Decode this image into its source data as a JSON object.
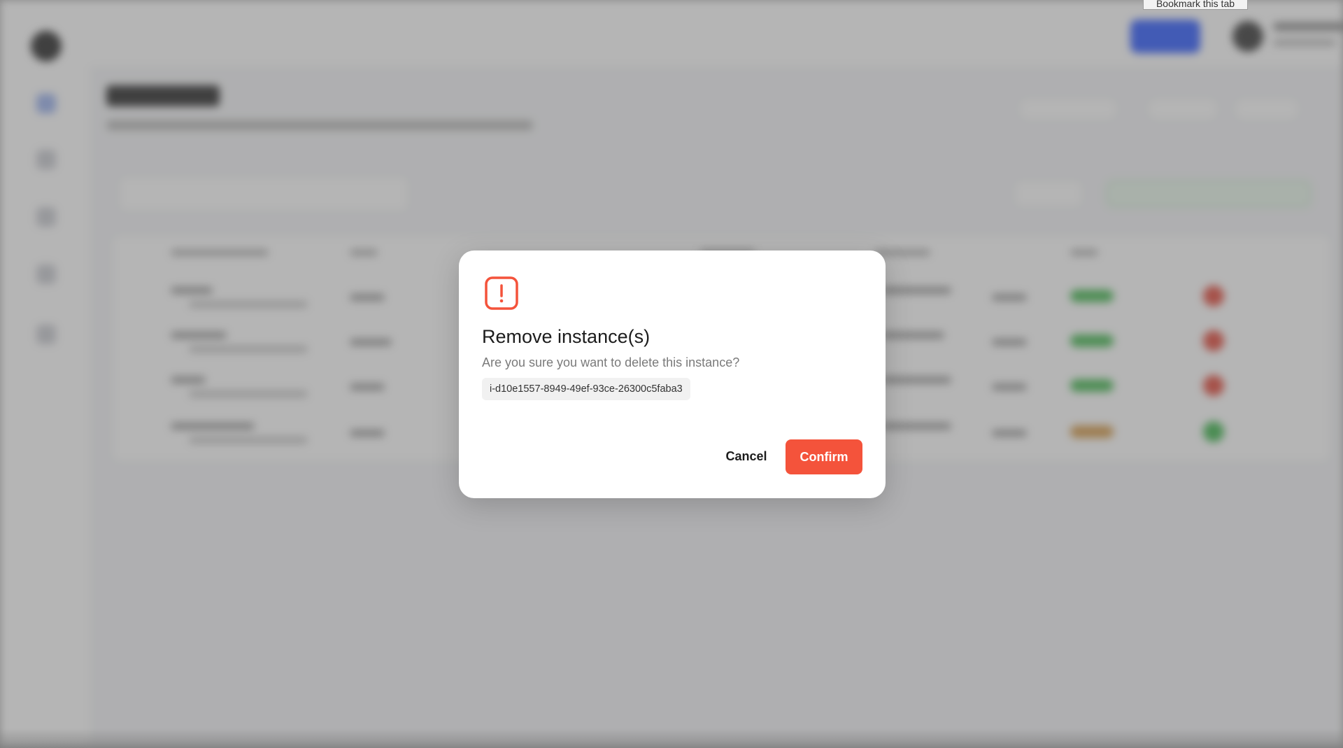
{
  "tooltip": {
    "text": "Bookmark this tab"
  },
  "dialog": {
    "title": "Remove instance(s)",
    "message": "Are you sure you want to delete this instance?",
    "instance_id": "i-d10e1557-8949-49ef-93ce-26300c5faba3",
    "cancel_label": "Cancel",
    "confirm_label": "Confirm",
    "icon": "alert-square-icon",
    "accent_color": "#f4533b"
  }
}
